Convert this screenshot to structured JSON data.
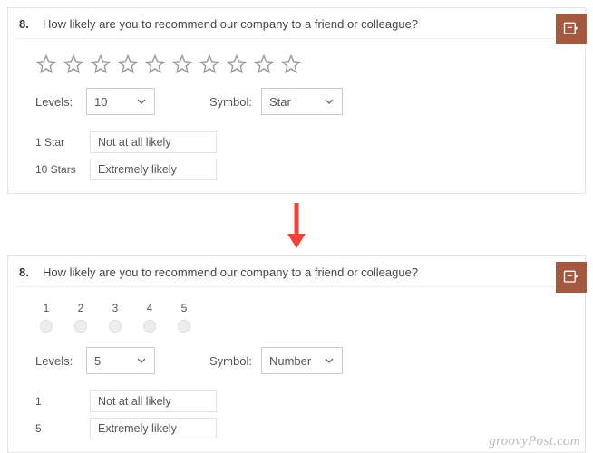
{
  "top": {
    "number": "8.",
    "question": "How likely are you to recommend our company to a friend or colleague?",
    "levels_label": "Levels:",
    "levels_value": "10",
    "star_count": 10,
    "symbol_label": "Symbol:",
    "symbol_value": "Star",
    "legend": {
      "lo_key": "1 Star",
      "lo_val": "Not at all likely",
      "hi_key": "10 Stars",
      "hi_val": "Extremely likely"
    }
  },
  "bottom": {
    "number": "8.",
    "question": "How likely are you to recommend our company to a friend or colleague?",
    "numbers": [
      "1",
      "2",
      "3",
      "4",
      "5"
    ],
    "levels_label": "Levels:",
    "levels_value": "5",
    "symbol_label": "Symbol:",
    "symbol_value": "Number",
    "legend": {
      "lo_key": "1",
      "lo_val": "Not at all likely",
      "hi_key": "5",
      "hi_val": "Extremely likely"
    }
  },
  "watermark": "groovyPost.com"
}
